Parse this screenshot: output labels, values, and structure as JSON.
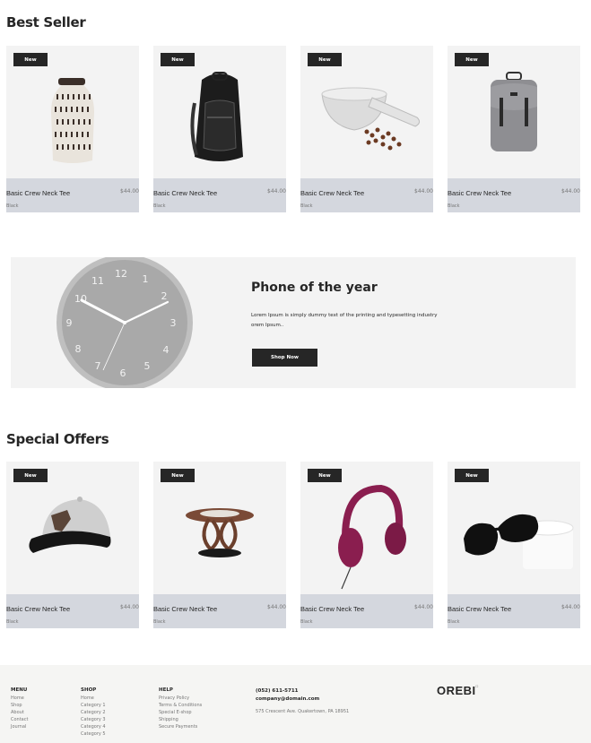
{
  "best_seller": {
    "title": "Best Seller",
    "products": [
      {
        "badge": "New",
        "name": "Basic Crew Neck Tee",
        "price": "$44.00",
        "color": "Black",
        "image": "vase"
      },
      {
        "badge": "New",
        "name": "Basic Crew Neck Tee",
        "price": "$44.00",
        "color": "Black",
        "image": "black-backpack"
      },
      {
        "badge": "New",
        "name": "Basic Crew Neck Tee",
        "price": "$44.00",
        "color": "Black",
        "image": "mortar-pestle"
      },
      {
        "badge": "New",
        "name": "Basic Crew Neck Tee",
        "price": "$44.00",
        "color": "Black",
        "image": "grey-backpack"
      }
    ]
  },
  "ad_banner": {
    "title": "Phone of the year",
    "description": "Lorem Ipsum is simply dummy text of the printing and typesetting industry orem Ipsum..",
    "button_label": "Shop Now",
    "clock_numbers": [
      "12",
      "1",
      "2",
      "3",
      "4",
      "5",
      "6",
      "7",
      "8",
      "9",
      "10",
      "11"
    ]
  },
  "special_offers": {
    "title": "Special Offers",
    "products": [
      {
        "badge": "New",
        "name": "Basic Crew Neck Tee",
        "price": "$44.00",
        "color": "Black",
        "image": "cap"
      },
      {
        "badge": "New",
        "name": "Basic Crew Neck Tee",
        "price": "$44.00",
        "color": "Black",
        "image": "side-table"
      },
      {
        "badge": "New",
        "name": "Basic Crew Neck Tee",
        "price": "$44.00",
        "color": "Black",
        "image": "headphones"
      },
      {
        "badge": "New",
        "name": "Basic Crew Neck Tee",
        "price": "$44.00",
        "color": "Black",
        "image": "sunglasses"
      }
    ]
  },
  "footer": {
    "menu": {
      "heading": "MENU",
      "links": [
        "Home",
        "Shop",
        "About",
        "Contact",
        "Journal"
      ]
    },
    "shop": {
      "heading": "SHOP",
      "links": [
        "Home",
        "Category 1",
        "Category 2",
        "Category 3",
        "Category 4",
        "Category 5"
      ]
    },
    "help": {
      "heading": "HELP",
      "links": [
        "Privacy Policy",
        "Terms & Conditions",
        "Special E-shop",
        "Shipping",
        "Secure Payments"
      ]
    },
    "contact": {
      "phone": "(052) 611-5711",
      "email": "company@domain.com",
      "address": "575 Crescent Ave. Quakertown, PA 18951"
    },
    "logo": "OREBI",
    "logo_mark": "□"
  }
}
